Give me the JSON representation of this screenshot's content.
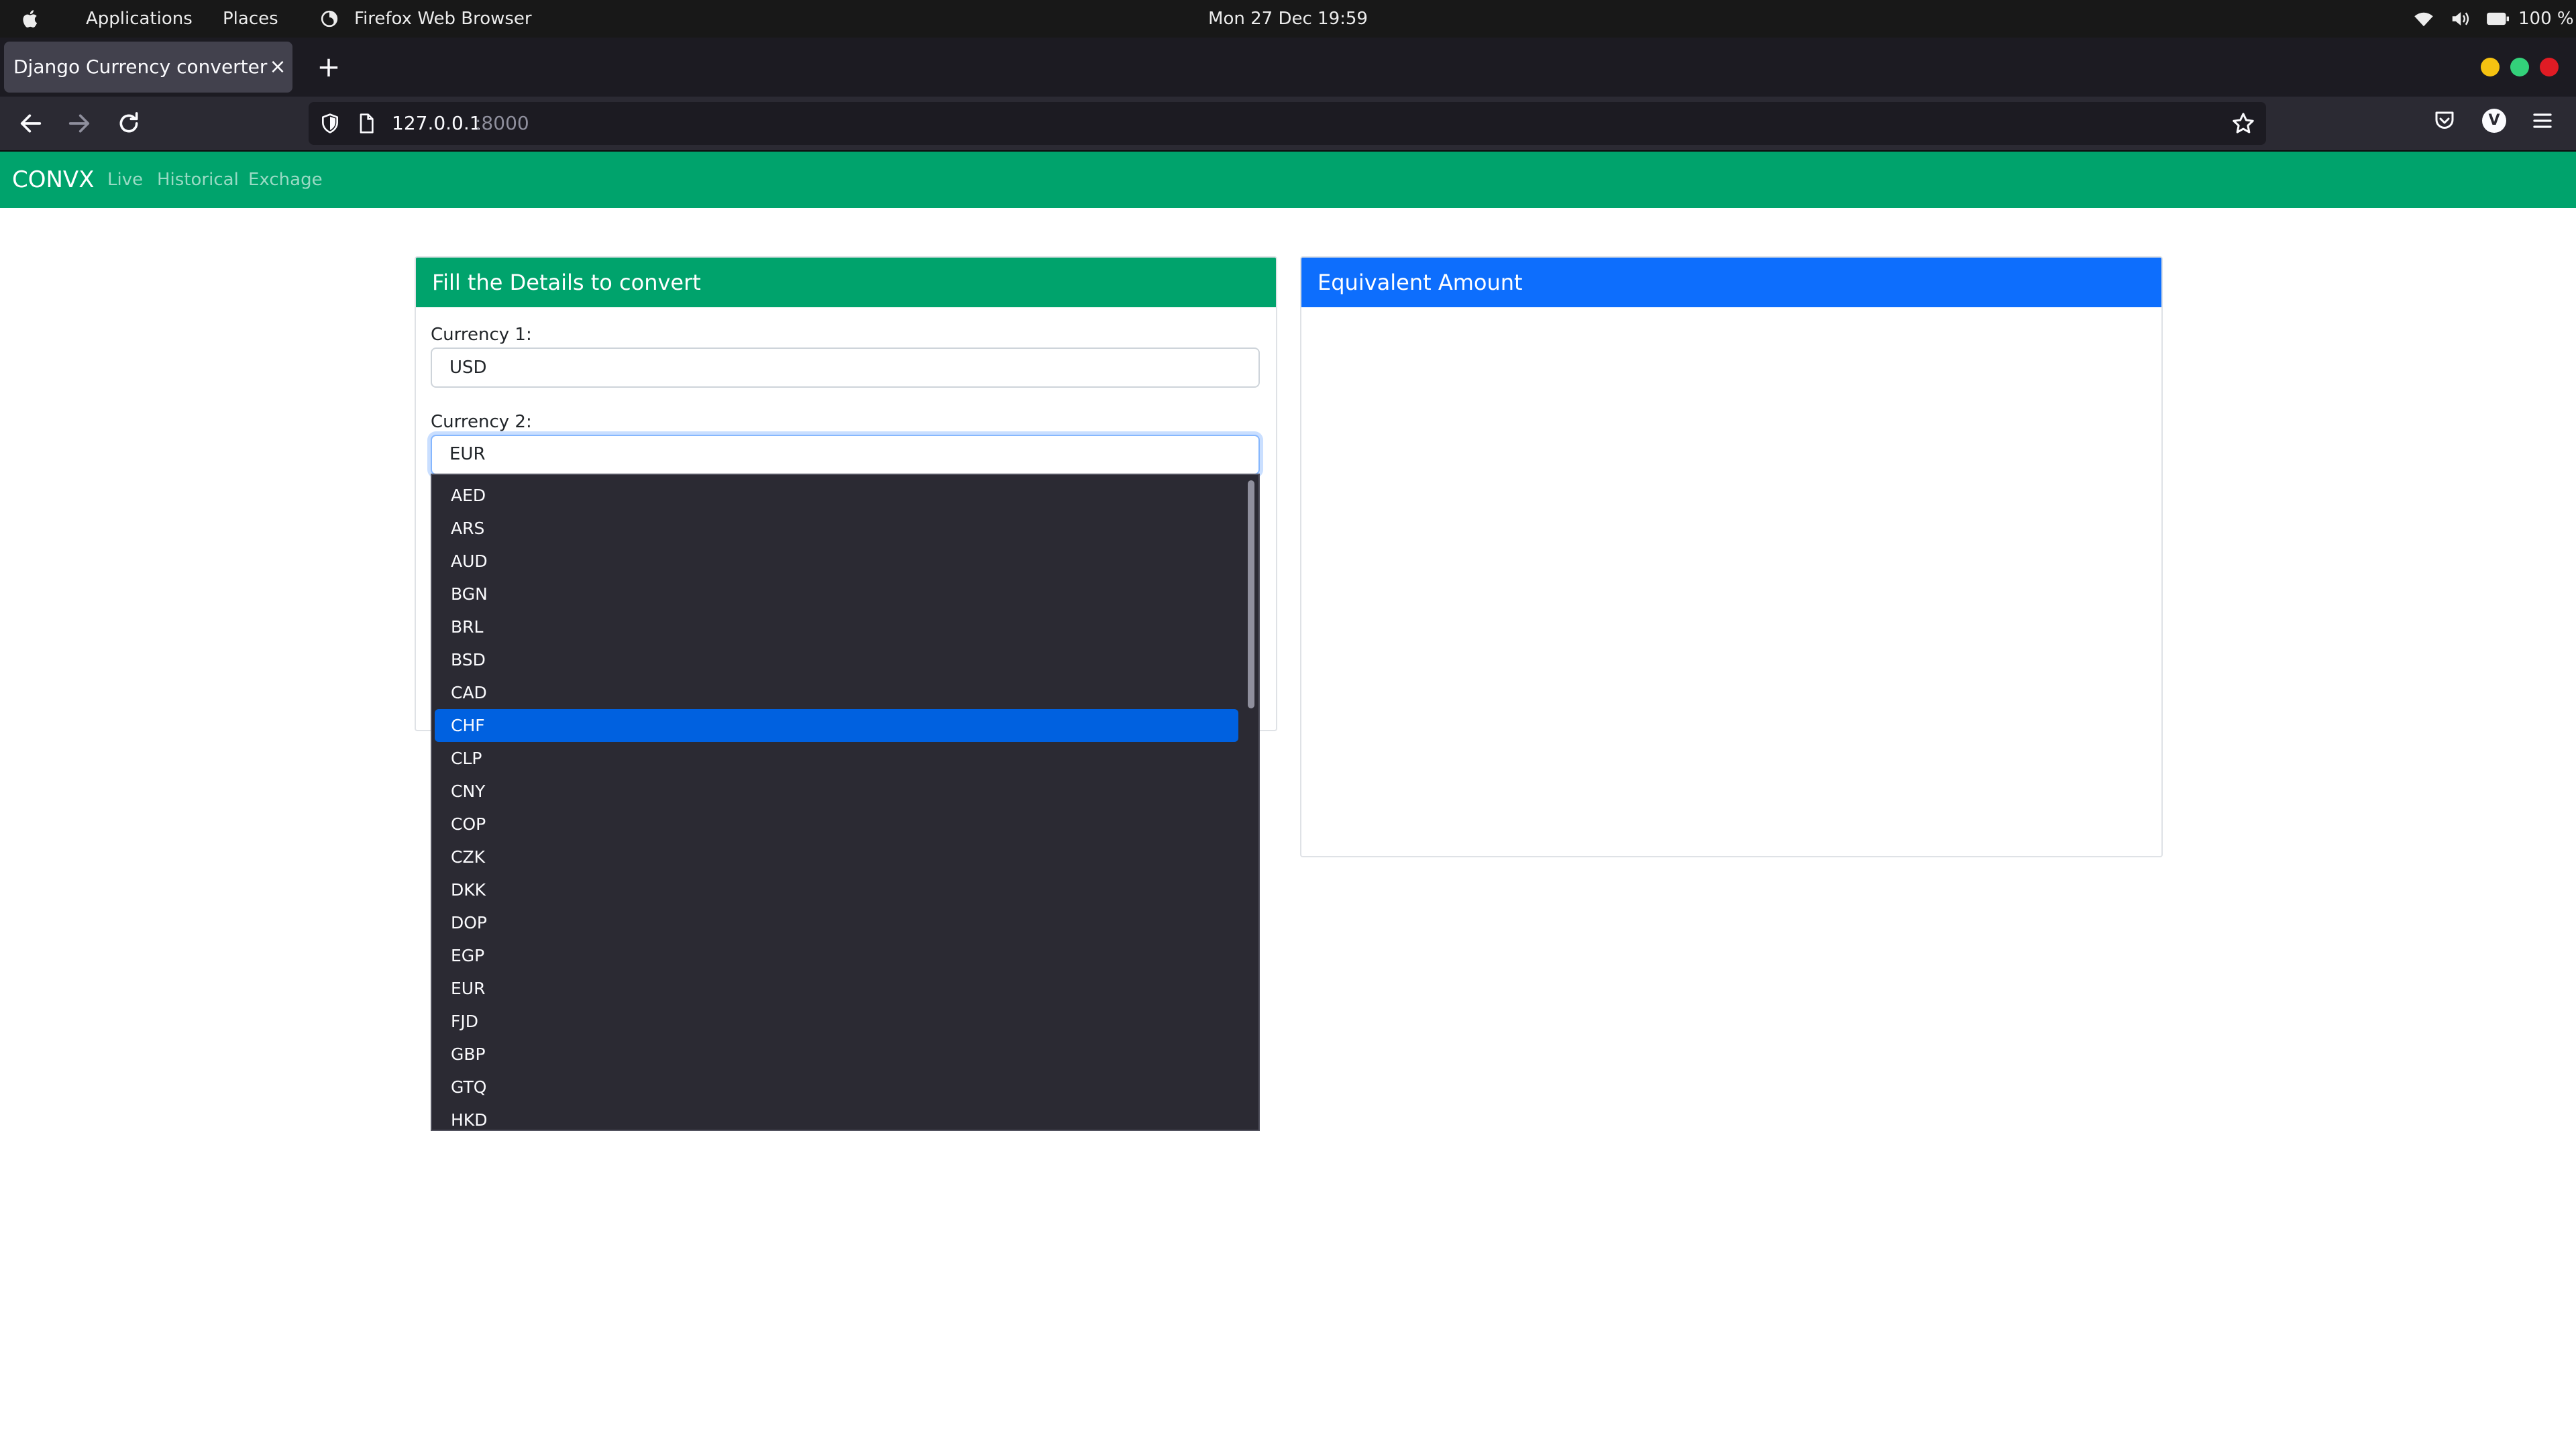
{
  "os_bar": {
    "applications": "Applications",
    "places": "Places",
    "active_app": "Firefox Web Browser",
    "clock": "Mon 27 Dec  19:59",
    "battery": "100 %"
  },
  "browser": {
    "tab_title": "Django Currency converter",
    "tab_close": "×",
    "new_tab": "+",
    "url_host": "127.0.0.1",
    "url_port": ":8000",
    "account_initial": "V"
  },
  "site": {
    "brand": "CONVX",
    "nav": [
      "Live",
      "Historical",
      "Exchage"
    ],
    "accent_green": "#00a36c",
    "accent_blue": "#0d6efd"
  },
  "form": {
    "title": "Fill the Details to convert",
    "currency1_label": "Currency 1:",
    "currency1_value": "USD",
    "currency2_label": "Currency 2:",
    "currency2_value": "EUR"
  },
  "result": {
    "title": "Equivalent Amount",
    "value": ""
  },
  "dropdown": {
    "options": [
      "AED",
      "ARS",
      "AUD",
      "BGN",
      "BRL",
      "BSD",
      "CAD",
      "CHF",
      "CLP",
      "CNY",
      "COP",
      "CZK",
      "DKK",
      "DOP",
      "EGP",
      "EUR",
      "FJD",
      "GBP",
      "GTQ",
      "HKD"
    ],
    "highlighted": "CHF"
  },
  "icons": {
    "os": [
      "apple-icon",
      "firefox-icon",
      "wifi-icon",
      "volume-icon",
      "battery-icon"
    ],
    "toolbar": [
      "back-icon",
      "forward-icon",
      "reload-icon",
      "shield-icon",
      "page-icon",
      "star-icon",
      "pocket-icon",
      "menu-icon"
    ]
  }
}
